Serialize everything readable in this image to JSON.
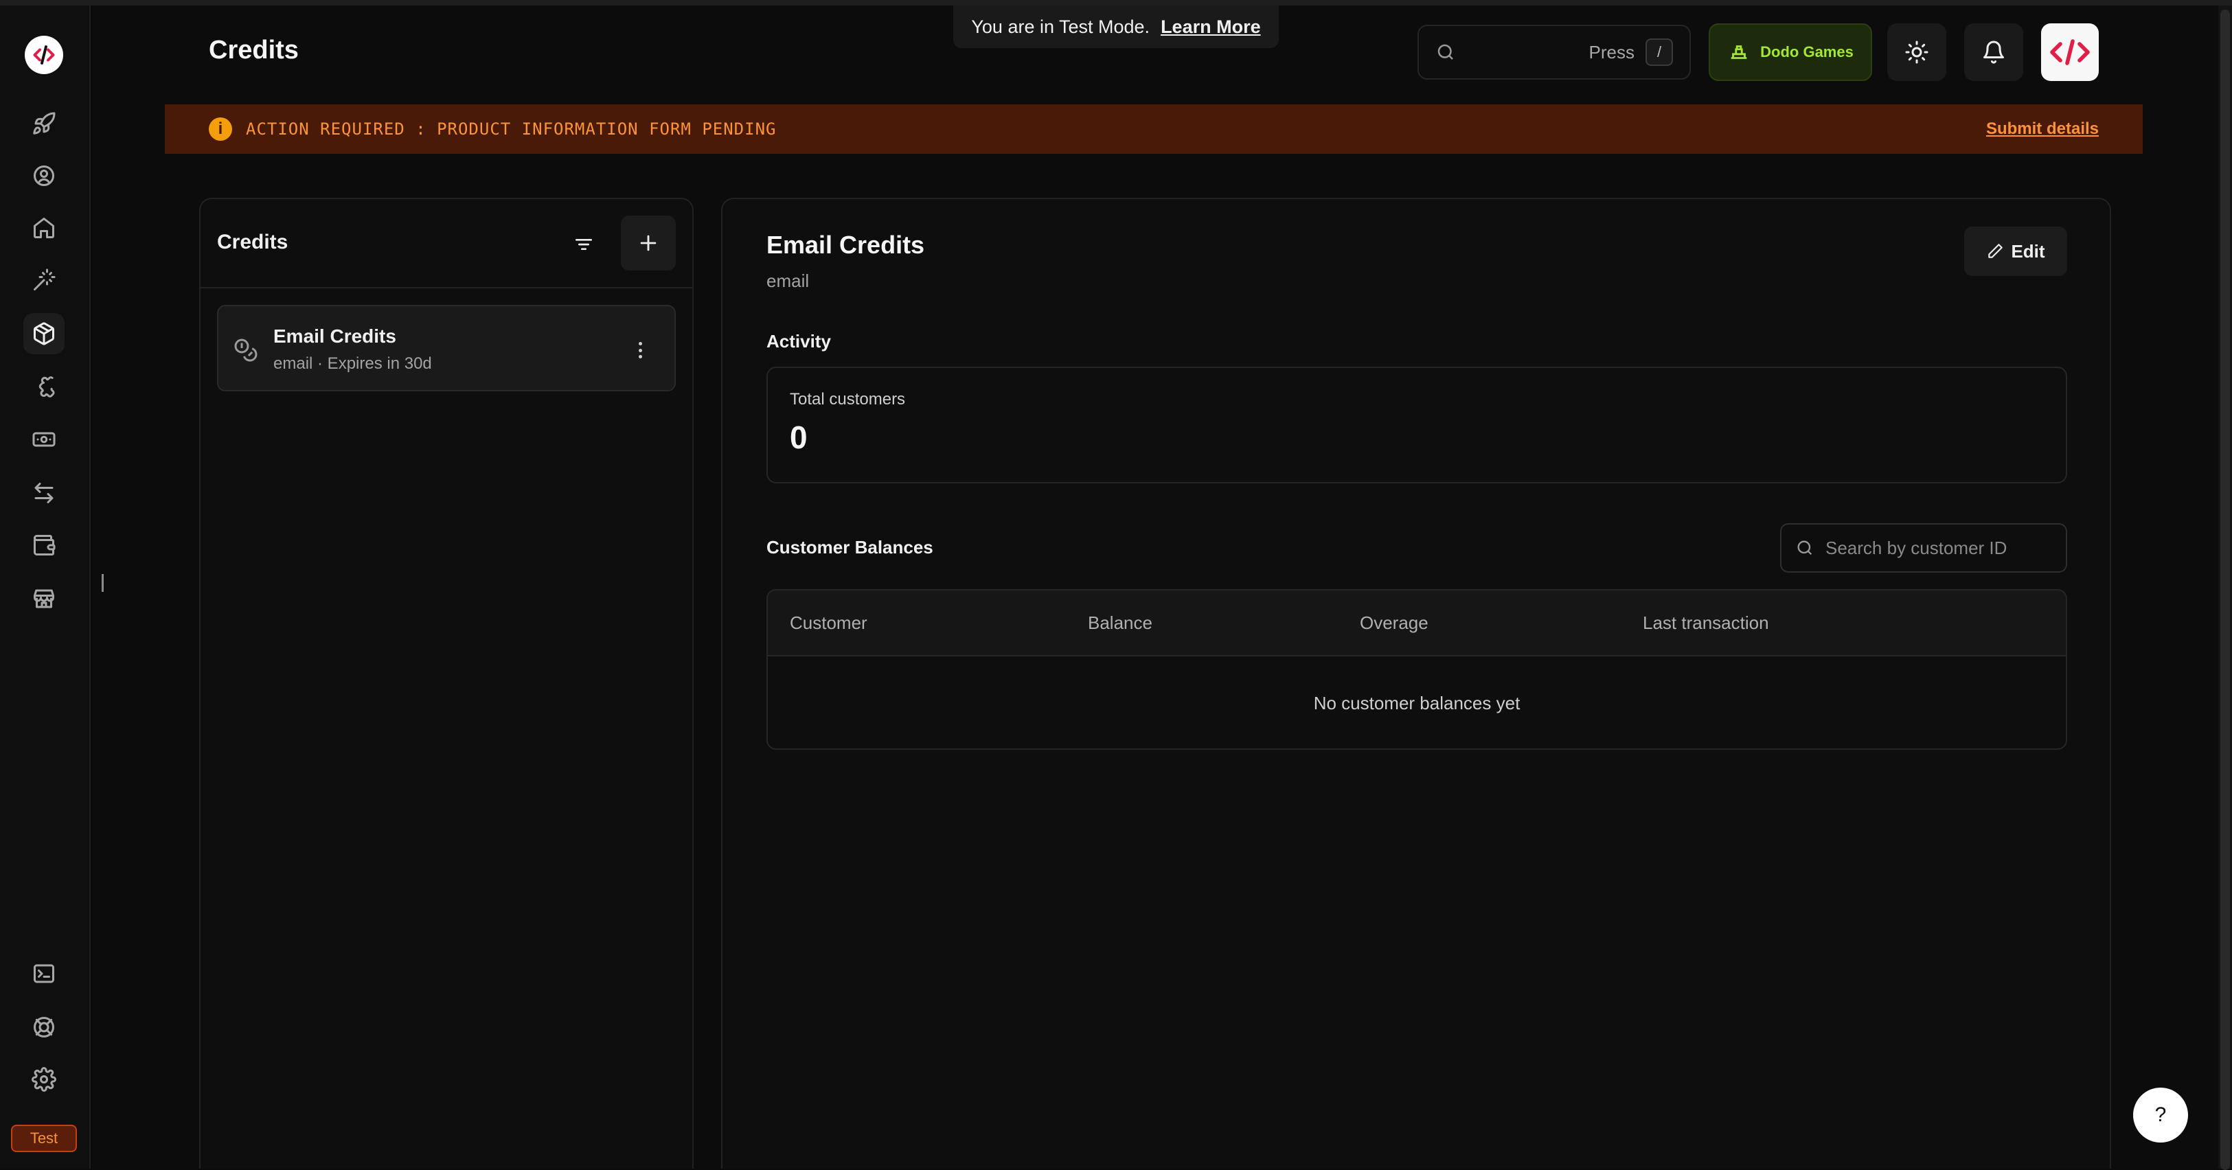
{
  "page": {
    "title": "Credits"
  },
  "test_mode": {
    "text": "You are in Test Mode.",
    "link": "Learn More"
  },
  "header": {
    "search_press": "Press",
    "search_shortcut": "/",
    "business_name": "Dodo Games"
  },
  "banner": {
    "message": "ACTION REQUIRED : PRODUCT INFORMATION FORM PENDING",
    "action": "Submit details",
    "bg_color": "#4a1a08",
    "text_color": "#fb923c"
  },
  "sidebar": {
    "items": [
      {
        "icon": "rocket-icon"
      },
      {
        "icon": "user-target-icon"
      },
      {
        "icon": "home-icon"
      },
      {
        "icon": "magic-wand-icon"
      },
      {
        "icon": "package-icon",
        "active": true
      },
      {
        "icon": "puzzle-icon"
      },
      {
        "icon": "banknote-icon"
      },
      {
        "icon": "arrows-transfer-icon"
      },
      {
        "icon": "wallet-icon"
      },
      {
        "icon": "store-icon"
      }
    ],
    "bottom": [
      {
        "icon": "terminal-icon"
      },
      {
        "icon": "lifebuoy-icon"
      },
      {
        "icon": "settings-icon"
      }
    ],
    "mode_badge": "Test"
  },
  "credits_list": {
    "title": "Credits",
    "items": [
      {
        "name": "Email Credits",
        "subtitle": "email · Expires in 30d"
      }
    ]
  },
  "detail": {
    "title": "Email Credits",
    "subtitle": "email",
    "edit_label": "Edit",
    "activity_label": "Activity",
    "stat": {
      "label": "Total customers",
      "value": "0"
    },
    "balances_label": "Customer Balances",
    "search_placeholder": "Search by customer ID",
    "table": {
      "columns": [
        "Customer",
        "Balance",
        "Overage",
        "Last transaction"
      ],
      "empty_text": "No customer balances yet"
    }
  },
  "help_label": "?"
}
